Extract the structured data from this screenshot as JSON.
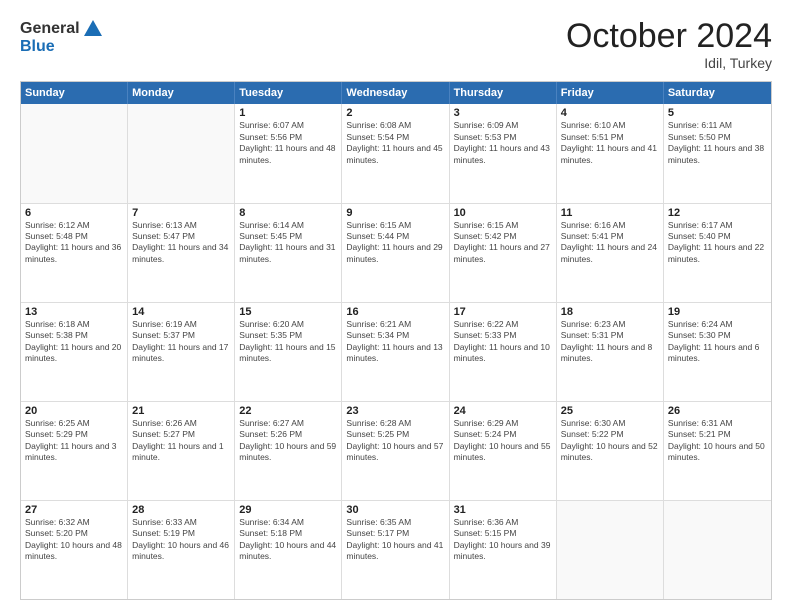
{
  "header": {
    "logo_general": "General",
    "logo_blue": "Blue",
    "month": "October 2024",
    "location": "Idil, Turkey"
  },
  "weekdays": [
    "Sunday",
    "Monday",
    "Tuesday",
    "Wednesday",
    "Thursday",
    "Friday",
    "Saturday"
  ],
  "rows": [
    [
      {
        "day": "",
        "text": ""
      },
      {
        "day": "",
        "text": ""
      },
      {
        "day": "1",
        "text": "Sunrise: 6:07 AM\nSunset: 5:56 PM\nDaylight: 11 hours and 48 minutes."
      },
      {
        "day": "2",
        "text": "Sunrise: 6:08 AM\nSunset: 5:54 PM\nDaylight: 11 hours and 45 minutes."
      },
      {
        "day": "3",
        "text": "Sunrise: 6:09 AM\nSunset: 5:53 PM\nDaylight: 11 hours and 43 minutes."
      },
      {
        "day": "4",
        "text": "Sunrise: 6:10 AM\nSunset: 5:51 PM\nDaylight: 11 hours and 41 minutes."
      },
      {
        "day": "5",
        "text": "Sunrise: 6:11 AM\nSunset: 5:50 PM\nDaylight: 11 hours and 38 minutes."
      }
    ],
    [
      {
        "day": "6",
        "text": "Sunrise: 6:12 AM\nSunset: 5:48 PM\nDaylight: 11 hours and 36 minutes."
      },
      {
        "day": "7",
        "text": "Sunrise: 6:13 AM\nSunset: 5:47 PM\nDaylight: 11 hours and 34 minutes."
      },
      {
        "day": "8",
        "text": "Sunrise: 6:14 AM\nSunset: 5:45 PM\nDaylight: 11 hours and 31 minutes."
      },
      {
        "day": "9",
        "text": "Sunrise: 6:15 AM\nSunset: 5:44 PM\nDaylight: 11 hours and 29 minutes."
      },
      {
        "day": "10",
        "text": "Sunrise: 6:15 AM\nSunset: 5:42 PM\nDaylight: 11 hours and 27 minutes."
      },
      {
        "day": "11",
        "text": "Sunrise: 6:16 AM\nSunset: 5:41 PM\nDaylight: 11 hours and 24 minutes."
      },
      {
        "day": "12",
        "text": "Sunrise: 6:17 AM\nSunset: 5:40 PM\nDaylight: 11 hours and 22 minutes."
      }
    ],
    [
      {
        "day": "13",
        "text": "Sunrise: 6:18 AM\nSunset: 5:38 PM\nDaylight: 11 hours and 20 minutes."
      },
      {
        "day": "14",
        "text": "Sunrise: 6:19 AM\nSunset: 5:37 PM\nDaylight: 11 hours and 17 minutes."
      },
      {
        "day": "15",
        "text": "Sunrise: 6:20 AM\nSunset: 5:35 PM\nDaylight: 11 hours and 15 minutes."
      },
      {
        "day": "16",
        "text": "Sunrise: 6:21 AM\nSunset: 5:34 PM\nDaylight: 11 hours and 13 minutes."
      },
      {
        "day": "17",
        "text": "Sunrise: 6:22 AM\nSunset: 5:33 PM\nDaylight: 11 hours and 10 minutes."
      },
      {
        "day": "18",
        "text": "Sunrise: 6:23 AM\nSunset: 5:31 PM\nDaylight: 11 hours and 8 minutes."
      },
      {
        "day": "19",
        "text": "Sunrise: 6:24 AM\nSunset: 5:30 PM\nDaylight: 11 hours and 6 minutes."
      }
    ],
    [
      {
        "day": "20",
        "text": "Sunrise: 6:25 AM\nSunset: 5:29 PM\nDaylight: 11 hours and 3 minutes."
      },
      {
        "day": "21",
        "text": "Sunrise: 6:26 AM\nSunset: 5:27 PM\nDaylight: 11 hours and 1 minute."
      },
      {
        "day": "22",
        "text": "Sunrise: 6:27 AM\nSunset: 5:26 PM\nDaylight: 10 hours and 59 minutes."
      },
      {
        "day": "23",
        "text": "Sunrise: 6:28 AM\nSunset: 5:25 PM\nDaylight: 10 hours and 57 minutes."
      },
      {
        "day": "24",
        "text": "Sunrise: 6:29 AM\nSunset: 5:24 PM\nDaylight: 10 hours and 55 minutes."
      },
      {
        "day": "25",
        "text": "Sunrise: 6:30 AM\nSunset: 5:22 PM\nDaylight: 10 hours and 52 minutes."
      },
      {
        "day": "26",
        "text": "Sunrise: 6:31 AM\nSunset: 5:21 PM\nDaylight: 10 hours and 50 minutes."
      }
    ],
    [
      {
        "day": "27",
        "text": "Sunrise: 6:32 AM\nSunset: 5:20 PM\nDaylight: 10 hours and 48 minutes."
      },
      {
        "day": "28",
        "text": "Sunrise: 6:33 AM\nSunset: 5:19 PM\nDaylight: 10 hours and 46 minutes."
      },
      {
        "day": "29",
        "text": "Sunrise: 6:34 AM\nSunset: 5:18 PM\nDaylight: 10 hours and 44 minutes."
      },
      {
        "day": "30",
        "text": "Sunrise: 6:35 AM\nSunset: 5:17 PM\nDaylight: 10 hours and 41 minutes."
      },
      {
        "day": "31",
        "text": "Sunrise: 6:36 AM\nSunset: 5:15 PM\nDaylight: 10 hours and 39 minutes."
      },
      {
        "day": "",
        "text": ""
      },
      {
        "day": "",
        "text": ""
      }
    ]
  ]
}
